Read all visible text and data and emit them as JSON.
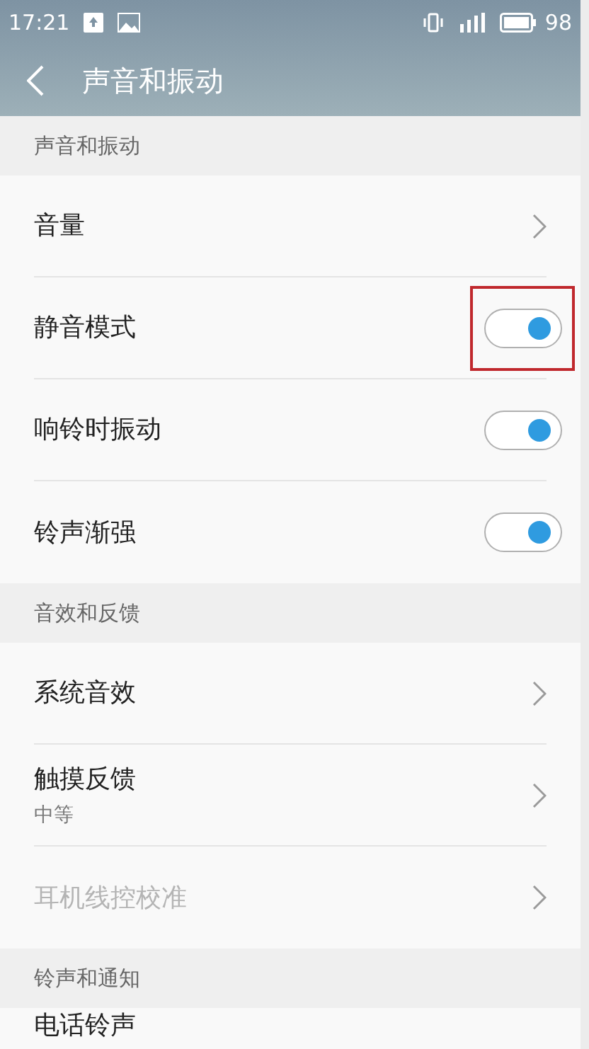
{
  "status_bar": {
    "time": "17:21",
    "battery": "98"
  },
  "header": {
    "title": "声音和振动"
  },
  "sections": [
    {
      "title": "声音和振动",
      "items": [
        {
          "kind": "link",
          "label": "音量",
          "disabled": false
        },
        {
          "kind": "toggle",
          "label": "静音模式",
          "on": true,
          "highlighted": true
        },
        {
          "kind": "toggle",
          "label": "响铃时振动",
          "on": true,
          "highlighted": false
        },
        {
          "kind": "toggle",
          "label": "铃声渐强",
          "on": true,
          "highlighted": false
        }
      ]
    },
    {
      "title": "音效和反馈",
      "items": [
        {
          "kind": "link",
          "label": "系统音效",
          "disabled": false
        },
        {
          "kind": "link",
          "label": "触摸反馈",
          "subtitle": "中等",
          "disabled": false
        },
        {
          "kind": "link",
          "label": "耳机线控校准",
          "disabled": true
        }
      ]
    },
    {
      "title": "铃声和通知",
      "items": [
        {
          "kind": "cut",
          "label": "电话铃声"
        }
      ]
    }
  ]
}
